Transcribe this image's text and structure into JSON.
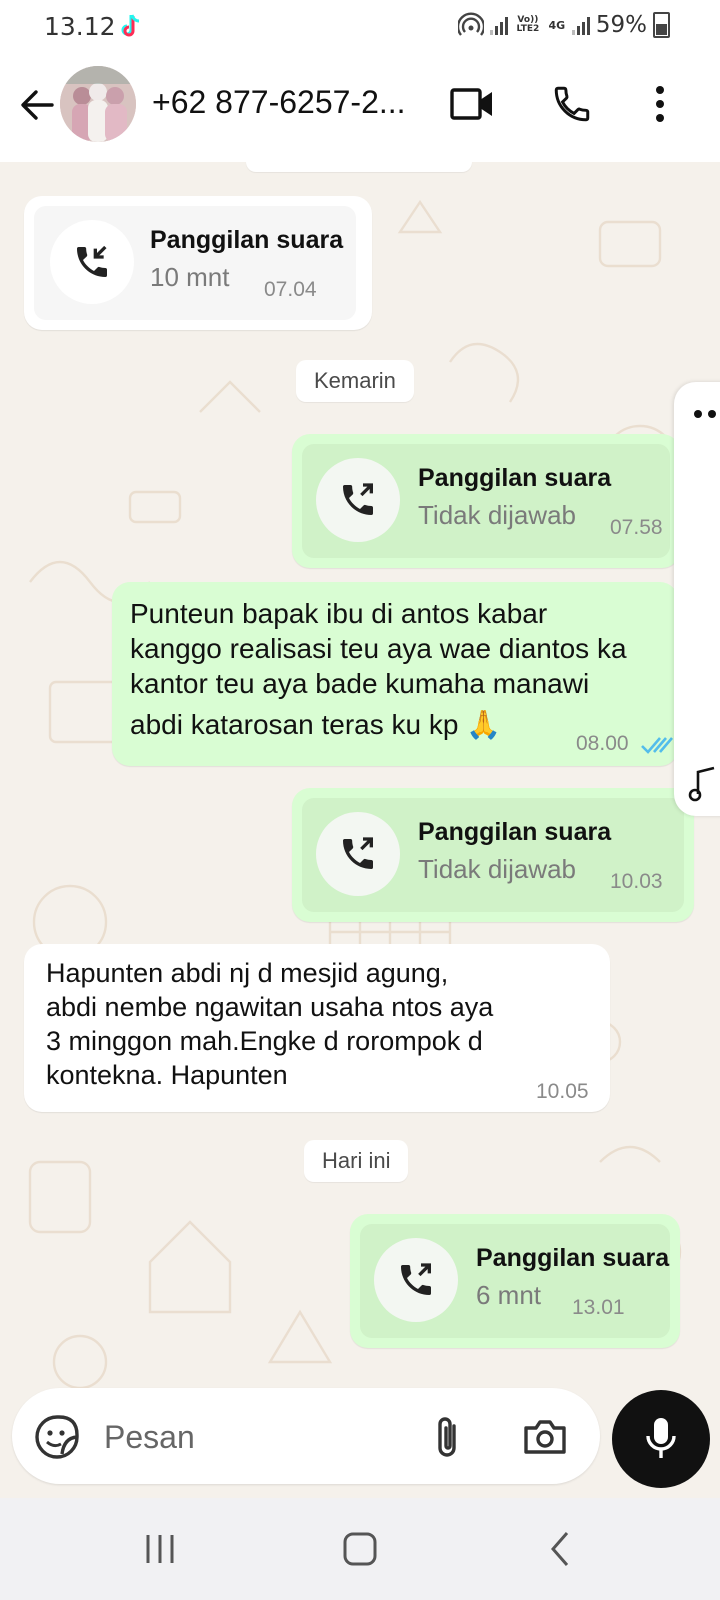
{
  "status_bar": {
    "time": "13.12",
    "battery": "59%",
    "volte_label": "Vo)) LTE2",
    "network_label": "4G"
  },
  "header": {
    "title": "+62 877-6257-2..."
  },
  "chat": {
    "messages": [
      {
        "direction": "incoming",
        "type": "call",
        "title": "Panggilan suara",
        "subtitle": "10 mnt",
        "time": "07.04"
      },
      {
        "type": "date",
        "label": "Kemarin"
      },
      {
        "direction": "outgoing",
        "type": "call",
        "title": "Panggilan suara",
        "subtitle": "Tidak dijawab",
        "time": "07.58"
      },
      {
        "direction": "outgoing",
        "type": "text",
        "lines": [
          "Punteun bapak ibu di antos kabar",
          "kanggo realisasi teu aya wae diantos ka",
          "kantor teu aya bade kumaha manawi",
          "abdi katarosan teras ku kp 🙏"
        ],
        "time": "08.00",
        "status": "read"
      },
      {
        "direction": "outgoing",
        "type": "call",
        "title": "Panggilan suara",
        "subtitle": "Tidak dijawab",
        "time": "10.03"
      },
      {
        "direction": "incoming",
        "type": "text",
        "lines": [
          "Hapunten abdi nj d mesjid agung,",
          "abdi nembe ngawitan usaha ntos aya",
          "3 minggon mah.Engke d rorompok d",
          "kontekna. Hapunten"
        ],
        "time": "10.05"
      },
      {
        "type": "date",
        "label": "Hari ini"
      },
      {
        "direction": "outgoing",
        "type": "call",
        "title": "Panggilan suara",
        "subtitle": "6 mnt",
        "time": "13.01"
      }
    ]
  },
  "composer": {
    "placeholder": "Pesan"
  },
  "colors": {
    "outgoing_bubble": "#d9fdd3",
    "incoming_bubble": "#ffffff",
    "chat_background": "#f5f1eb",
    "read_ticks": "#53bdeb"
  }
}
